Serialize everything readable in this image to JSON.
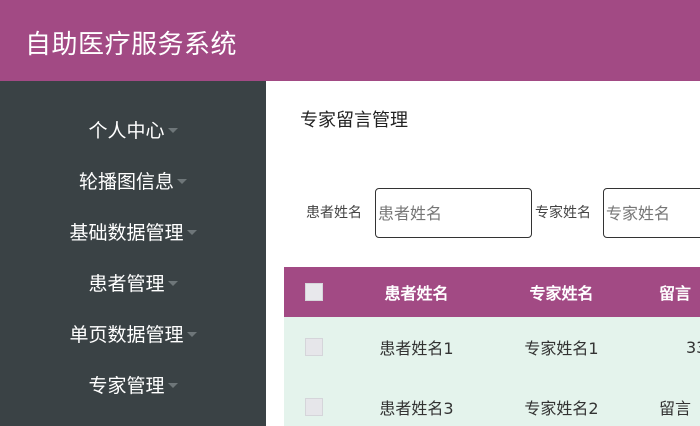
{
  "app": {
    "title": "自助医疗服务系统"
  },
  "sidebar": {
    "items": [
      {
        "label": "个人中心"
      },
      {
        "label": "轮播图信息"
      },
      {
        "label": "基础数据管理"
      },
      {
        "label": "患者管理"
      },
      {
        "label": "单页数据管理"
      },
      {
        "label": "专家管理"
      }
    ]
  },
  "main": {
    "page_title": "专家留言管理",
    "filters": {
      "patient_label": "患者姓名",
      "patient_placeholder": "患者姓名",
      "expert_label": "专家姓名",
      "expert_placeholder": "专家姓名"
    },
    "table": {
      "headers": [
        "患者姓名",
        "专家姓名",
        "留言"
      ],
      "rows": [
        {
          "patient": "患者姓名1",
          "expert": "专家姓名1",
          "message": "33"
        },
        {
          "patient": "患者姓名3",
          "expert": "专家姓名2",
          "message": "留言"
        }
      ]
    }
  },
  "colors": {
    "header_bg": "#a24a84",
    "sidebar_bg": "#3a4245",
    "row_bg": "#e4f3ec"
  },
  "icons": [
    "chevron-down-icon",
    "checkbox"
  ]
}
